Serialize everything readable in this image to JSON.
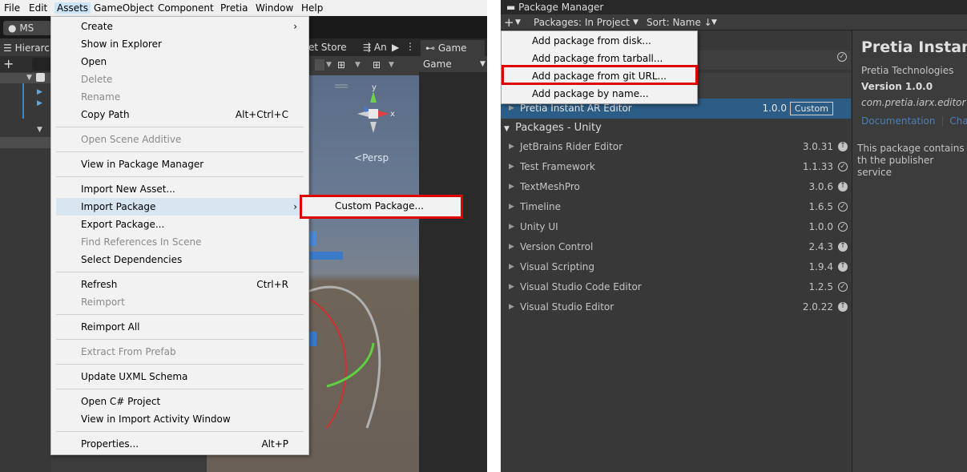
{
  "menubar": {
    "items": [
      "File",
      "Edit",
      "Assets",
      "GameObject",
      "Component",
      "Pretia",
      "Window",
      "Help"
    ]
  },
  "toolbar": {
    "account": "MS"
  },
  "hierarchy": {
    "tab": "Hierarc"
  },
  "scene": {
    "tabs": [
      "et Store",
      "An"
    ],
    "persp": "Persp"
  },
  "game": {
    "tab": "Game",
    "sub": "Game"
  },
  "assets_menu": [
    {
      "label": "Create",
      "submenu": true
    },
    {
      "label": "Show in Explorer"
    },
    {
      "label": "Open"
    },
    {
      "label": "Delete",
      "disabled": true
    },
    {
      "label": "Rename",
      "disabled": true
    },
    {
      "label": "Copy Path",
      "shortcut": "Alt+Ctrl+C"
    },
    {
      "label": "Open Scene Additive",
      "disabled": true
    },
    {
      "label": "View in Package Manager"
    },
    {
      "label": "Import New Asset..."
    },
    {
      "label": "Import Package",
      "submenu": true,
      "highlighted": true
    },
    {
      "label": "Export Package..."
    },
    {
      "label": "Find References In Scene",
      "disabled": true
    },
    {
      "label": "Select Dependencies"
    },
    {
      "label": "Refresh",
      "shortcut": "Ctrl+R"
    },
    {
      "label": "Reimport",
      "disabled": true
    },
    {
      "label": "Reimport All"
    },
    {
      "label": "Extract From Prefab",
      "disabled": true
    },
    {
      "label": "Update UXML Schema"
    },
    {
      "label": "Open C# Project"
    },
    {
      "label": "View in Import Activity Window"
    },
    {
      "label": "Properties...",
      "shortcut": "Alt+P"
    }
  ],
  "import_submenu": {
    "item": "Custom Package..."
  },
  "package_manager": {
    "title": "Package Manager",
    "scope": "Packages: In Project",
    "sort": "Sort: Name ↓",
    "add_menu": [
      "Add package from disk...",
      "Add package from tarball...",
      "Add package from git URL...",
      "Add package by name..."
    ],
    "selected_package": {
      "name": "Pretia Instant AR Editor",
      "version": "1.0.0",
      "badge": "Custom"
    },
    "group_title": "Packages - Unity",
    "packages": [
      {
        "name": "JetBrains Rider Editor",
        "version": "3.0.31",
        "status": "update"
      },
      {
        "name": "Test Framework",
        "version": "1.1.33",
        "status": "ok"
      },
      {
        "name": "TextMeshPro",
        "version": "3.0.6",
        "status": "update"
      },
      {
        "name": "Timeline",
        "version": "1.6.5",
        "status": "ok"
      },
      {
        "name": "Unity UI",
        "version": "1.0.0",
        "status": "ok"
      },
      {
        "name": "Version Control",
        "version": "2.4.3",
        "status": "update"
      },
      {
        "name": "Visual Scripting",
        "version": "1.9.4",
        "status": "update"
      },
      {
        "name": "Visual Studio Code Editor",
        "version": "1.2.5",
        "status": "ok"
      },
      {
        "name": "Visual Studio Editor",
        "version": "2.0.22",
        "status": "update"
      }
    ],
    "details": {
      "title": "Pretia Instant A",
      "author": "Pretia Technologies",
      "version": "Version 1.0.0",
      "id": "com.pretia.iarx.editor",
      "links": [
        "Documentation",
        "Chan"
      ],
      "description": "This package contains th the publisher service"
    }
  }
}
